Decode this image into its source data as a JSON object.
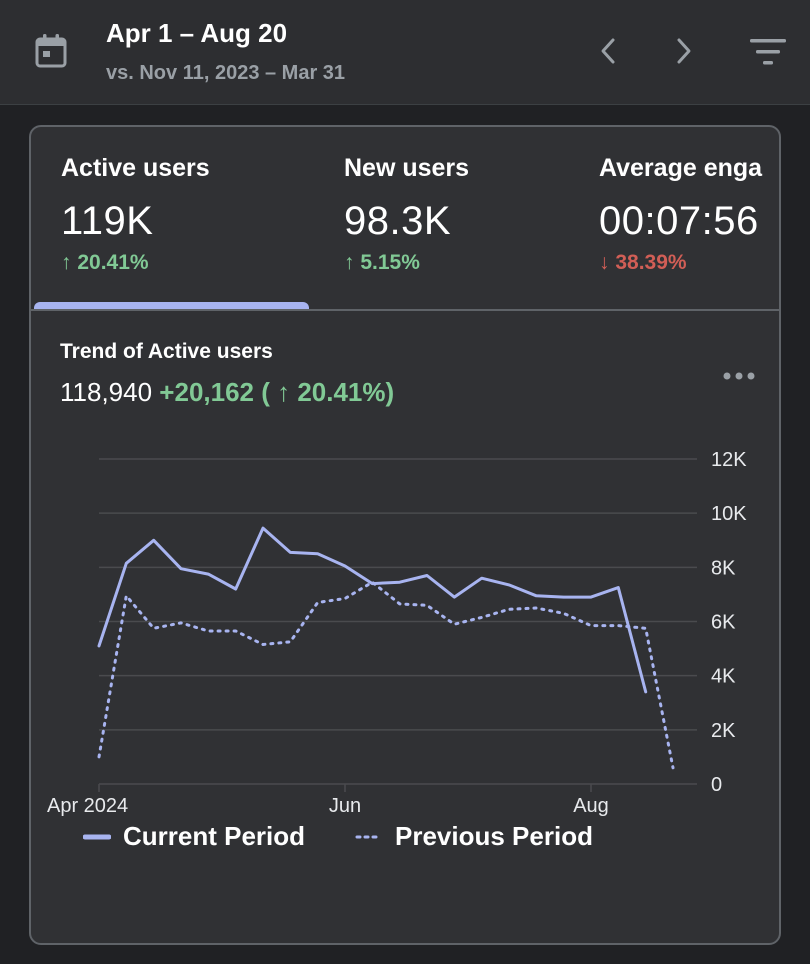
{
  "header": {
    "date_range": "Apr 1 – Aug 20",
    "compare_range": "vs. Nov 11, 2023 – Mar 31",
    "icons": {
      "calendar": "calendar-icon",
      "prev": "chevron-left-icon",
      "next": "chevron-right-icon",
      "filter": "filter-icon"
    }
  },
  "metrics": [
    {
      "label": "Active users",
      "value": "119K",
      "change": "↑ 20.41%",
      "direction": "up"
    },
    {
      "label": "New users",
      "value": "98.3K",
      "change": "↑ 5.15%",
      "direction": "up"
    },
    {
      "label": "Average enga",
      "value": "00:07:56",
      "change": "↓ 38.39%",
      "direction": "down"
    }
  ],
  "trend": {
    "title": "Trend of Active users",
    "total": "118,940",
    "delta": "+20,162 ( ↑ 20.41%)",
    "more_icon": "more-horizontal-icon"
  },
  "colors": {
    "current": "#a8b4f0",
    "previous": "#a8b4f0",
    "up": "#81c995",
    "down": "#ee675c",
    "grid": "#4a4b4e"
  },
  "chart_data": {
    "type": "line",
    "x_tick_labels": [
      "Apr 2024",
      "Jun",
      "Aug"
    ],
    "x_tick_index": [
      0,
      9,
      18
    ],
    "y_ticks": [
      0,
      2000,
      4000,
      6000,
      8000,
      10000,
      12000
    ],
    "y_tick_labels": [
      "0",
      "2K",
      "4K",
      "6K",
      "8K",
      "10K",
      "12K"
    ],
    "ylim": [
      0,
      12000
    ],
    "grid": true,
    "legend_position": "bottom",
    "series": [
      {
        "name": "Current Period",
        "style": "solid",
        "x": [
          0,
          1,
          2,
          3,
          4,
          5,
          6,
          7,
          8,
          9,
          10,
          11,
          12,
          13,
          14,
          15,
          16,
          17,
          18,
          19,
          20,
          21
        ],
        "values": [
          5100,
          8150,
          9000,
          7950,
          7750,
          7200,
          9450,
          8550,
          8500,
          8050,
          7400,
          7450,
          7700,
          6900,
          7600,
          7350,
          6950,
          6900,
          6900,
          7250,
          3400,
          null
        ]
      },
      {
        "name": "Previous Period",
        "style": "dotted",
        "x": [
          0,
          1,
          2,
          3,
          4,
          5,
          6,
          7,
          8,
          9,
          10,
          11,
          12,
          13,
          14,
          15,
          16,
          17,
          18,
          19,
          20,
          21
        ],
        "values": [
          1000,
          6950,
          5750,
          5950,
          5650,
          5650,
          5150,
          5250,
          6700,
          6850,
          7450,
          6650,
          6600,
          5900,
          6150,
          6450,
          6500,
          6300,
          5850,
          5850,
          5750,
          600
        ]
      }
    ]
  }
}
